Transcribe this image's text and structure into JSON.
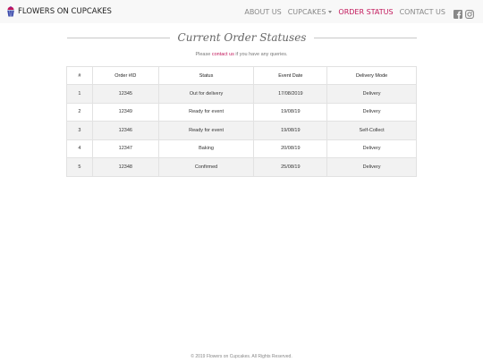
{
  "navbar": {
    "brand": "FLOWERS ON CUPCAKES",
    "brand_icon": "cupcake-icon",
    "links": [
      {
        "label": "ABOUT US",
        "active": false
      },
      {
        "label": "CUPCAKES",
        "active": false,
        "dropdown": true
      },
      {
        "label": "ORDER STATUS",
        "active": true
      },
      {
        "label": "CONTACT US",
        "active": false
      }
    ],
    "social": [
      "facebook-icon",
      "instagram-icon"
    ]
  },
  "page": {
    "title": "Current Order Statuses",
    "subtext_before": "Please ",
    "subtext_link": "contact us",
    "subtext_after": " if you have any queries."
  },
  "table": {
    "headers": [
      "#",
      "Order #ID",
      "Status",
      "Event Date",
      "Delivery Mode"
    ],
    "rows": [
      [
        "1",
        "12345",
        "Out for delivery",
        "17/08/2019",
        "Delivery"
      ],
      [
        "2",
        "12349",
        "Ready for event",
        "19/08/19",
        "Delivery"
      ],
      [
        "3",
        "12346",
        "Ready for event",
        "19/08/19",
        "Self-Collect"
      ],
      [
        "4",
        "12347",
        "Baking",
        "20/08/19",
        "Delivery"
      ],
      [
        "5",
        "12348",
        "Confirmed",
        "25/08/19",
        "Delivery"
      ]
    ]
  },
  "footer": {
    "text": "© 2019 Flowers on Cupcakes. All Rights Reserved."
  },
  "colors": {
    "accent": "#c2185b",
    "navbar_bg": "#f8f8f8",
    "row_stripe": "#f2f2f2"
  }
}
